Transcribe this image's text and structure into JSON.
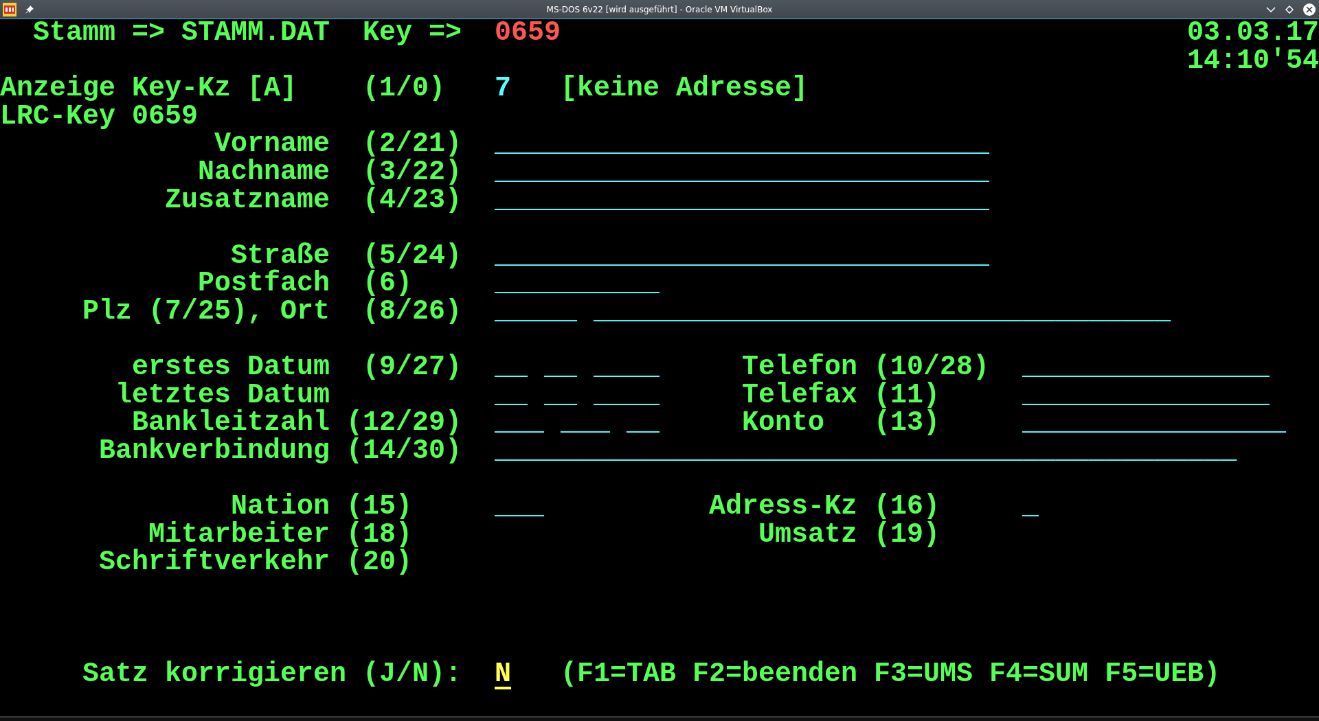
{
  "window": {
    "title": "MS-DOS 6v22 [wird ausgeführt] - Oracle VM VirtualBox"
  },
  "header": {
    "file": "Stamm => STAMM.DAT",
    "key_label": "Key =>",
    "key_value": "0659",
    "date": "03.03.17",
    "time": "14:10'54"
  },
  "display_key": {
    "label": "Anzeige Key-Kz [A]",
    "code": "(1/0)",
    "value": "7",
    "note": "[keine Adresse]"
  },
  "lrc_key": "LRC-Key 0659",
  "fields": [
    {
      "label": "Vorname",
      "code": "(2/21)",
      "entry": "______________________________"
    },
    {
      "label": "Nachname",
      "code": "(3/22)",
      "entry": "______________________________"
    },
    {
      "label": "Zusatzname",
      "code": "(4/23)",
      "entry": "______________________________"
    },
    {
      "label": "Straße",
      "code": "(5/24)",
      "entry": "______________________________"
    },
    {
      "label": "Postfach",
      "code": "(6)",
      "entry": "__________"
    },
    {
      "label": "Plz (7/25), Ort",
      "code": "(8/26)",
      "entry": "_____ ___________________________________"
    },
    {
      "label": "erstes Datum",
      "code": "(9/27)",
      "entry": "__ __ ____"
    },
    {
      "label": "letztes Datum",
      "entry": "__ __ ____"
    },
    {
      "label": "Bankleitzahl",
      "code": "(12/29)",
      "entry": "___ ___ __"
    },
    {
      "label": "Bankverbindung",
      "code": "(14/30)",
      "entry": "_____________________________________________"
    },
    {
      "label": "Nation",
      "code": "(15)",
      "entry": "___"
    },
    {
      "label": "Mitarbeiter",
      "code": "(18)"
    },
    {
      "label": "Schriftverkehr",
      "code": "(20)"
    }
  ],
  "right_fields": [
    {
      "label": "Telefon",
      "code": "(10/28)",
      "entry": "_______________"
    },
    {
      "label": "Telefax",
      "code": "(11)",
      "entry": "_______________"
    },
    {
      "label": "Konto",
      "code": "(13)",
      "entry": "________________"
    },
    {
      "label": "Adress-Kz",
      "code": "(16)",
      "entry": "_"
    },
    {
      "label": "Umsatz",
      "code": "(19)"
    }
  ],
  "prompt": {
    "label": "Satz korrigieren (J/N):",
    "answer": "N",
    "keys": "(F1=TAB F2=beenden F3=UMS F4=SUM F5=UEB)"
  }
}
